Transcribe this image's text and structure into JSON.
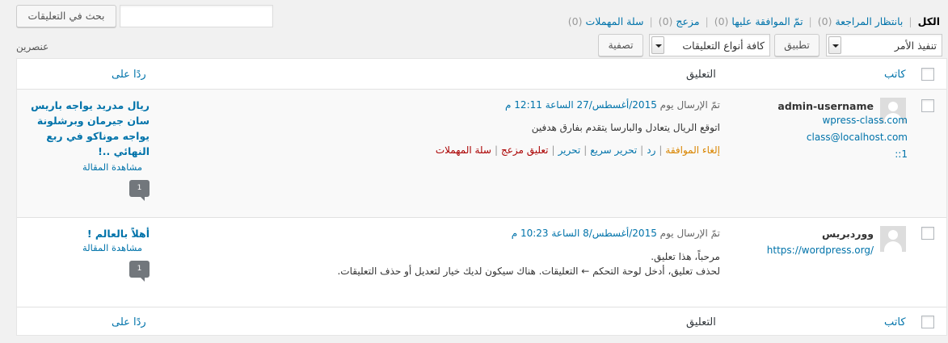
{
  "filters": {
    "all": "الكل",
    "pending": "بانتظار المراجعة",
    "pending_count": "(0)",
    "approved": "تمّ الموافقة عليها",
    "approved_count": "(0)",
    "spam": "مزعج",
    "spam_count": "(0)",
    "trash": "سلة المهملات",
    "trash_count": "(0)",
    "separator": "|"
  },
  "search": {
    "button_label": "بحث في التعليقات",
    "value": ""
  },
  "tablenav": {
    "bulk_action": "تنفيذ الأمر",
    "apply_label": "تطبيق",
    "comment_type": "كافة أنواع التعليقات",
    "filter_label": "تصفية",
    "items_count": "عنصرين"
  },
  "columns": {
    "author": "كاتب",
    "comment": "التعليق",
    "response": "ردًا على"
  },
  "comments": [
    {
      "author": "admin-username",
      "author_url": "wpress-class.com",
      "author_email": "class@localhost.com",
      "author_ip": "::1",
      "submitted_prefix": "تمّ الإرسال يوم",
      "submitted_date": "2015/أغسطس/27 الساعة 12:11 م",
      "lines": [
        "اتوقع الريال يتعادل والبارسا يتقدم بفارق هدفين"
      ],
      "actions": {
        "unapprove": "إلغاء الموافقة",
        "reply": "رد",
        "quick_edit": "تحرير سريع",
        "edit": "تحرير",
        "spam": "تعليق مزعج",
        "trash": "سلة المهملات"
      },
      "post_title": "ريال مدريد يواجه باريس سان جيرمان وبرشلونة يواجه موناكو في ربع النهائي ..!",
      "view_post": "مشاهدة المقالة",
      "count": "1"
    },
    {
      "author": "ووردبريس",
      "author_url": "https://wordpress.org/",
      "submitted_prefix": "تمّ الإرسال يوم",
      "submitted_date": "2015/أغسطس/8 الساعة 10:23 م",
      "lines": [
        "مرحباً، هذا تعليق.",
        "لحذف تعليق، أدخل لوحة التحكم ← التعليقات. هناك سيكون لديك خيار لتعديل أو حذف التعليقات."
      ],
      "post_title": "أهلاً بالعالم !",
      "view_post": "مشاهدة المقالة",
      "count": "1"
    }
  ]
}
